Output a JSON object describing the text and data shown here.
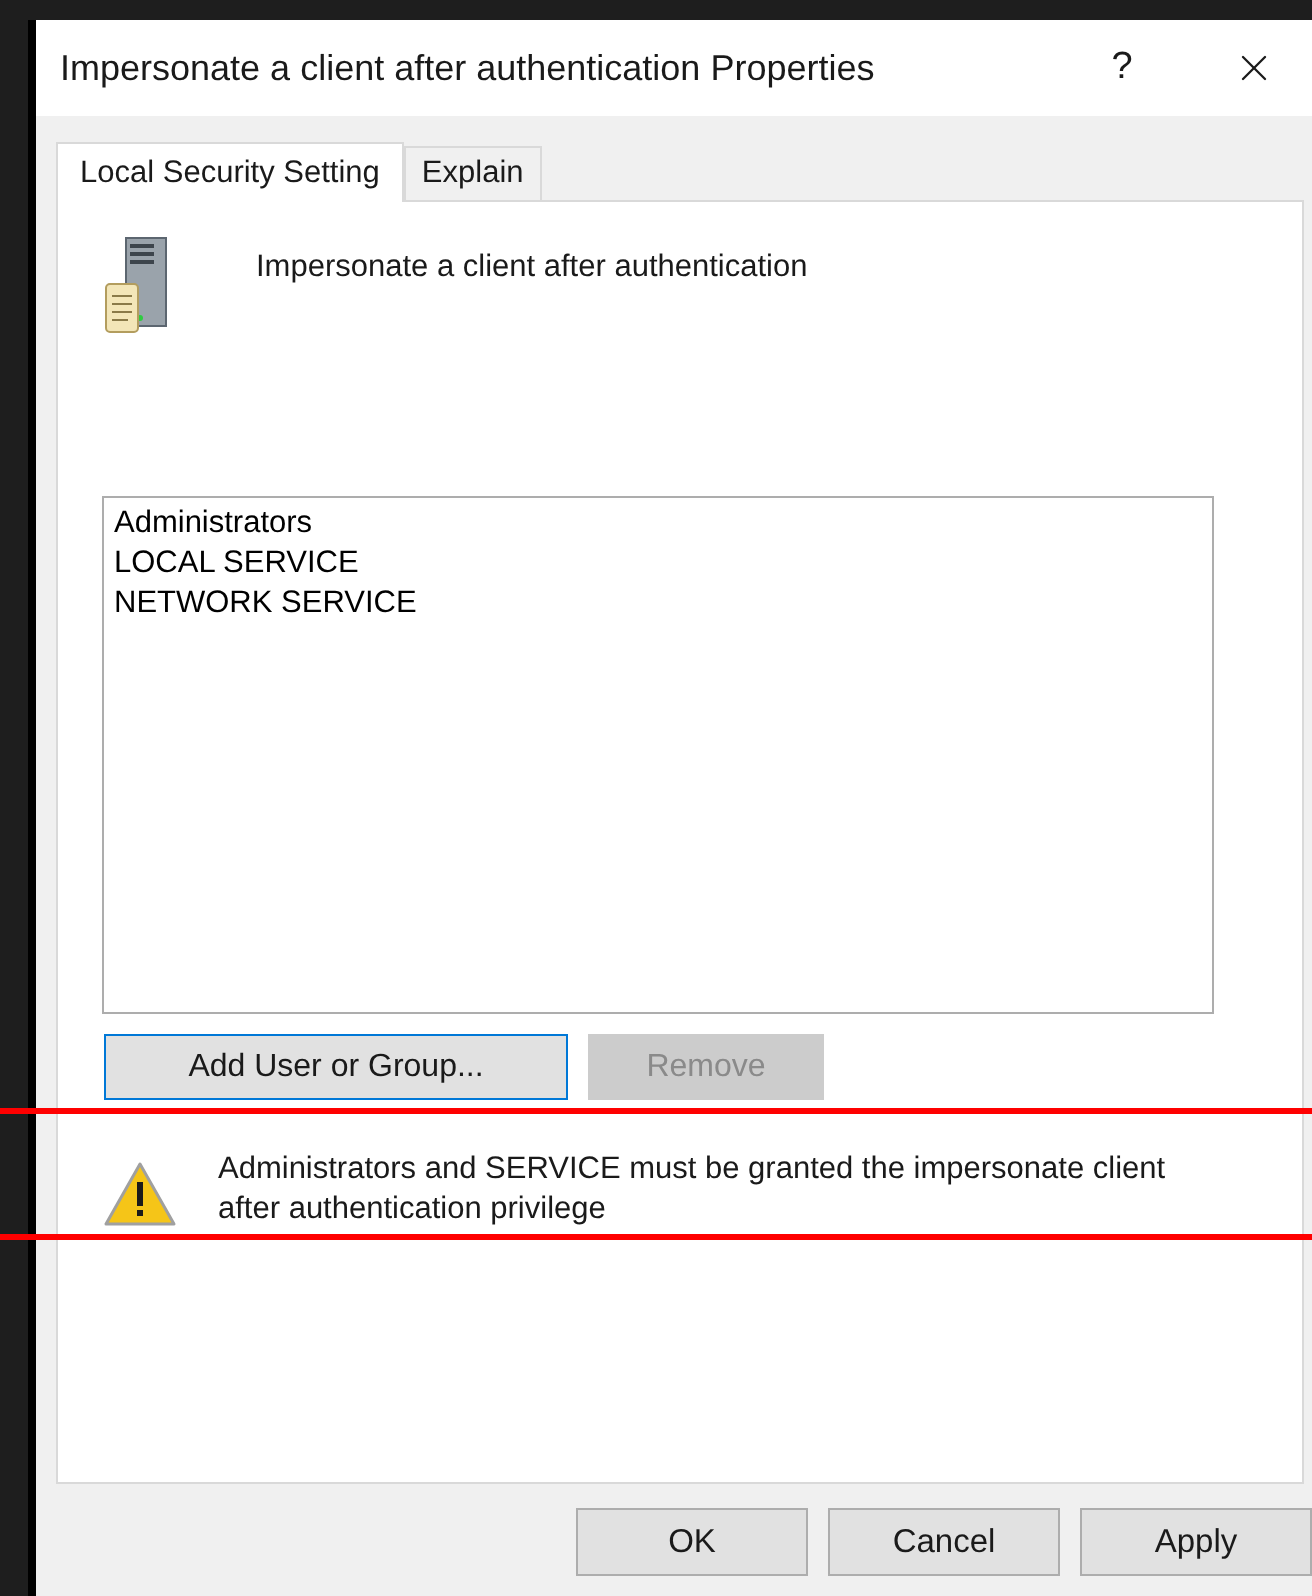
{
  "window": {
    "title": "Impersonate a client after authentication Properties",
    "help_button": "?"
  },
  "tabs": [
    {
      "label": "Local Security Setting",
      "selected": true
    },
    {
      "label": "Explain",
      "selected": false
    }
  ],
  "policy": {
    "name": "Impersonate a client after authentication"
  },
  "members": [
    {
      "name": "Administrators"
    },
    {
      "name": "LOCAL SERVICE"
    },
    {
      "name": "NETWORK SERVICE"
    }
  ],
  "member_buttons": [
    {
      "label": "Add User or Group...",
      "disabled": false,
      "focused": true
    },
    {
      "label": "Remove",
      "disabled": true,
      "focused": false
    }
  ],
  "warning": {
    "text": "Administrators and SERVICE must be granted the impersonate client after authentication privilege"
  },
  "dialog_buttons": [
    {
      "label": "OK"
    },
    {
      "label": "Cancel"
    },
    {
      "label": "Apply"
    }
  ]
}
